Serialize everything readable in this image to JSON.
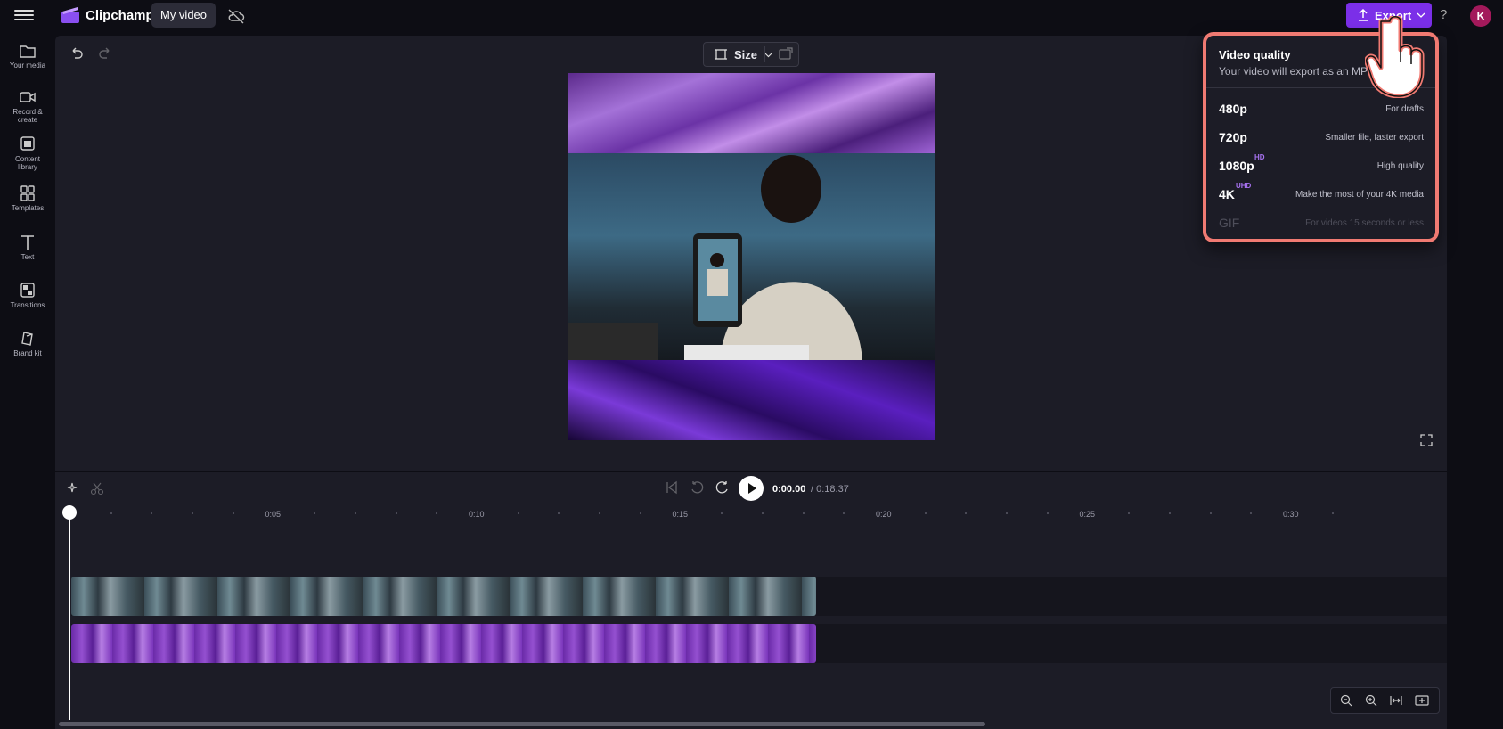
{
  "app": {
    "brand": "Clipchamp",
    "project_name": "My video",
    "export_label": "Export",
    "help": "?",
    "avatar_initial": "K",
    "accent_color": "#7b2fe8"
  },
  "sidebar": {
    "items": [
      {
        "label": "Your media",
        "icon": "folder-icon"
      },
      {
        "label": "Record & create",
        "icon": "camera-icon"
      },
      {
        "label": "Content library",
        "icon": "library-icon"
      },
      {
        "label": "Templates",
        "icon": "templates-icon"
      },
      {
        "label": "Text",
        "icon": "text-icon"
      },
      {
        "label": "Transitions",
        "icon": "transitions-icon"
      },
      {
        "label": "Brand kit",
        "icon": "brand-kit-icon"
      }
    ]
  },
  "preview": {
    "size_label": "Size"
  },
  "playback": {
    "current_time": "0:00.00",
    "total_time": "/ 0:18.37"
  },
  "timeline": {
    "ruler_labels": [
      "0:05",
      "0:10",
      "0:15",
      "0:20",
      "0:25",
      "0:30"
    ]
  },
  "export_menu": {
    "title": "Video quality",
    "subtitle": "Your video will export as an MP4 file",
    "options": [
      {
        "name": "480p",
        "badge": "",
        "desc": "For drafts",
        "enabled": true
      },
      {
        "name": "720p",
        "badge": "",
        "desc": "Smaller file, faster export",
        "enabled": true
      },
      {
        "name": "1080p",
        "badge": "HD",
        "desc": "High quality",
        "enabled": true
      },
      {
        "name": "4K",
        "badge": "UHD",
        "desc": "Make the most of your 4K media",
        "enabled": true
      },
      {
        "name": "GIF",
        "badge": "",
        "desc": "For videos 15 seconds or less",
        "enabled": false
      }
    ],
    "highlight_color": "#f07a72"
  }
}
